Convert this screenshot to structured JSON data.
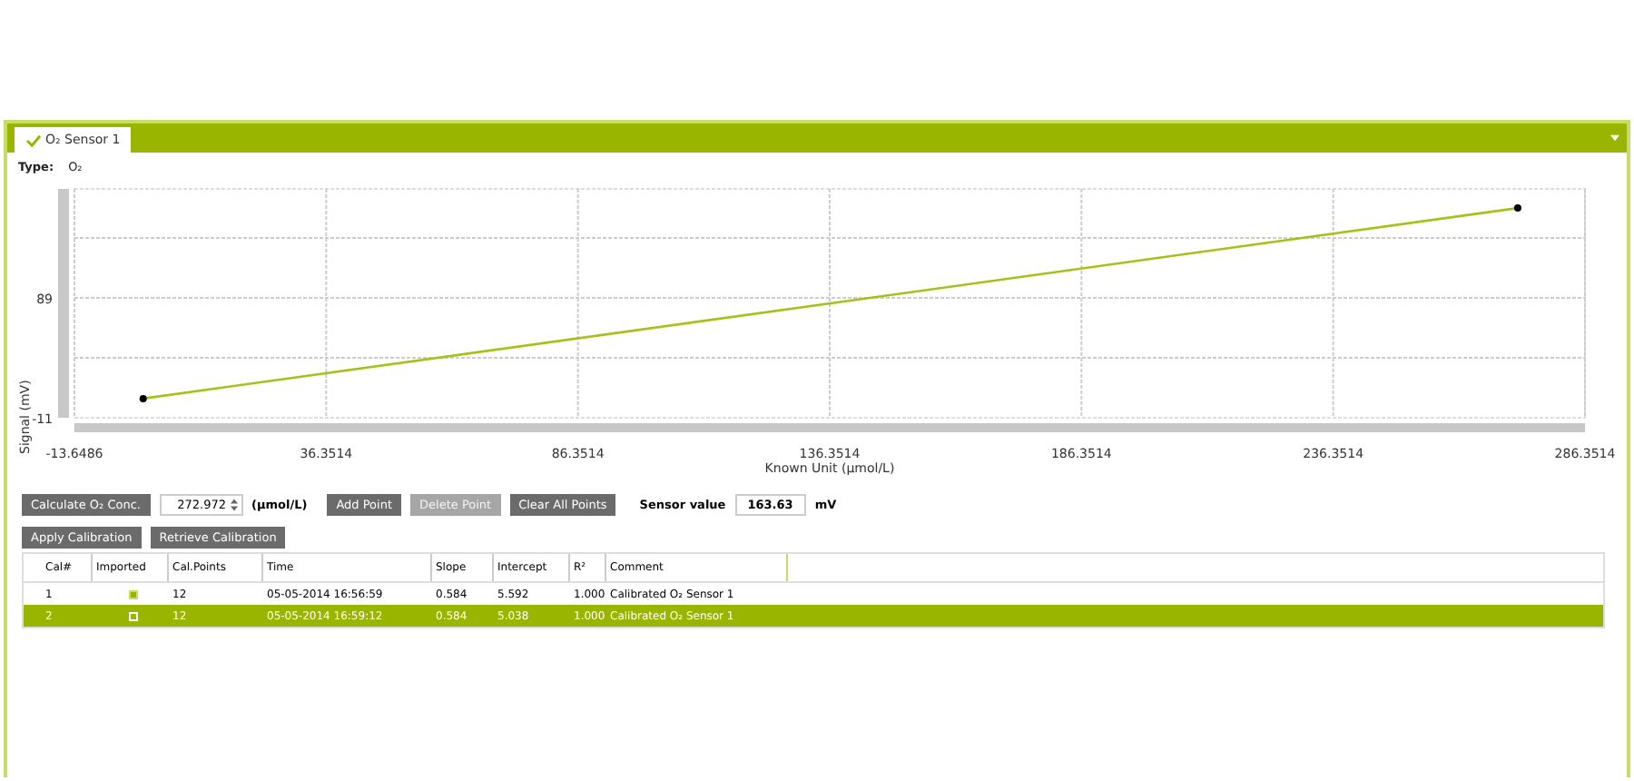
{
  "tab": {
    "label": "O₂ Sensor 1",
    "selected": true
  },
  "type": {
    "label": "Type:",
    "value": "O₂"
  },
  "chart_data": {
    "type": "line",
    "xlabel": "Known Unit (µmol/L)",
    "ylabel": "Signal (mV)",
    "xlim": [
      -13.6486,
      286.3514
    ],
    "ylim": [
      -11,
      180
    ],
    "xticks": [
      -13.6486,
      36.3514,
      86.3514,
      136.3514,
      186.3514,
      236.3514,
      286.3514
    ],
    "yticks": [
      -11,
      89
    ],
    "grid": true,
    "x": [
      0,
      273
    ],
    "series": [
      {
        "color": "#a4c21a",
        "marker": "circle",
        "values": [
          5,
          164
        ]
      }
    ]
  },
  "controls": {
    "calculate": "Calculate O₂ Conc.",
    "conc_value": "272.972",
    "conc_unit": "(µmol/L)",
    "add": "Add Point",
    "delete": {
      "label": "Delete Point",
      "disabled": true
    },
    "clear": "Clear All Points",
    "sensor_label": "Sensor value",
    "sensor_value": "163.63",
    "sensor_unit": "mV"
  },
  "actions": [
    "Apply Calibration",
    "Retrieve Calibration"
  ],
  "table": {
    "columns": [
      "Cal#",
      "Imported",
      "Cal.Points",
      "Time",
      "Slope",
      "Intercept",
      "R²",
      "Comment"
    ],
    "rows": [
      {
        "cal": "1",
        "imported": true,
        "points": "12",
        "time": "05-05-2014 16:56:59",
        "slope": "0.584",
        "intercept": "5.592",
        "r2": "1.000",
        "comment": "Calibrated O₂ Sensor 1",
        "selected": false
      },
      {
        "cal": "2",
        "imported": false,
        "points": "12",
        "time": "05-05-2014 16:59:12",
        "slope": "0.584",
        "intercept": "5.038",
        "r2": "1.000",
        "comment": "Calibrated O₂ Sensor 1",
        "selected": true
      }
    ]
  }
}
